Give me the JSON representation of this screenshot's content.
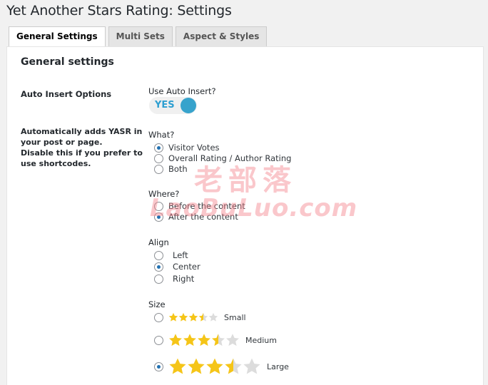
{
  "page": {
    "title": "Yet Another Stars Rating: Settings"
  },
  "tabs": [
    {
      "label": "General Settings",
      "active": true
    },
    {
      "label": "Multi Sets",
      "active": false
    },
    {
      "label": "Aspect & Styles",
      "active": false
    }
  ],
  "panel": {
    "section_title": "General settings",
    "auto_insert_label": "Auto Insert Options",
    "auto_insert_desc_1": "Automatically adds YASR in your post or page.",
    "auto_insert_desc_2": "Disable this if you prefer to use shortcodes."
  },
  "use_auto_insert": {
    "label": "Use Auto Insert?",
    "toggle_text": "YES",
    "enabled": true,
    "accent": "#37a3cc"
  },
  "what": {
    "label": "What?",
    "options": [
      {
        "label": "Visitor Votes",
        "checked": true
      },
      {
        "label": "Overall Rating / Author Rating",
        "checked": false
      },
      {
        "label": "Both",
        "checked": false
      }
    ]
  },
  "where": {
    "label": "Where?",
    "options": [
      {
        "label": "Before the content",
        "checked": false
      },
      {
        "label": "After the content",
        "checked": true
      }
    ]
  },
  "align": {
    "label": "Align",
    "options": [
      {
        "label": "Left",
        "checked": false
      },
      {
        "label": "Center",
        "checked": true
      },
      {
        "label": "Right",
        "checked": false
      }
    ]
  },
  "size": {
    "label": "Size",
    "rating": 3.5,
    "star_color": "#f5c518",
    "empty_color": "#dcdcdc",
    "options": [
      {
        "label": "Small",
        "checked": false
      },
      {
        "label": "Medium",
        "checked": false
      },
      {
        "label": "Large",
        "checked": true
      }
    ]
  },
  "watermark": {
    "cn": "老部落",
    "en": "LaoBuLuo.com"
  }
}
